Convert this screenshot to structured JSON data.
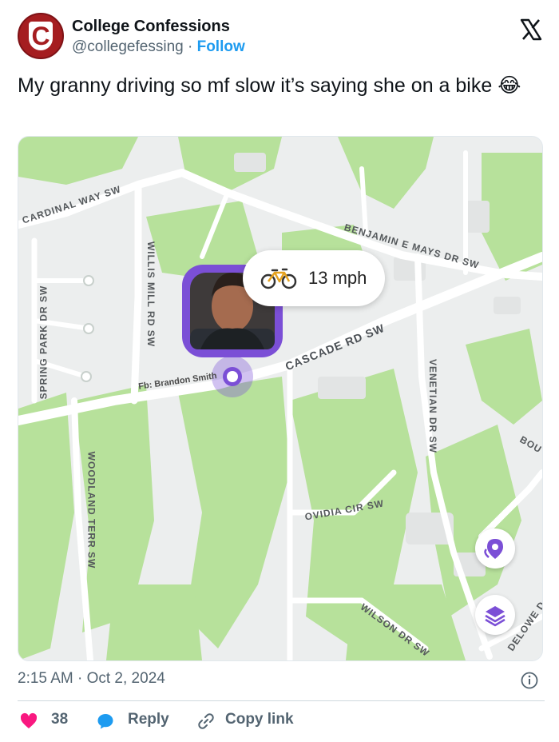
{
  "account": {
    "name": "College Confessions",
    "handle": "@collegefessing",
    "separator": "·",
    "follow_label": "Follow",
    "avatar_letter": "C"
  },
  "tweet": {
    "text": "My granny driving so mf slow it’s saying she on a bike 😂"
  },
  "map": {
    "speed_label": "13 mph",
    "fb_label": "Fb: Brandon Smith",
    "streets": {
      "cardinal": "CARDINAL WAY SW",
      "benjamin": "BENJAMIN E MAYS DR SW",
      "spring_park": "SPRING PARK DR SW",
      "willis_mill": "WILLIS MILL RD SW",
      "cascade": "CASCADE RD SW",
      "venetian": "VENETIAN DR SW",
      "woodland": "WOODLAND TERR SW",
      "ovidia": "OVIDIA CIR SW",
      "wilson": "WILSON DR SW",
      "delowe": "DELOWE D",
      "bou": "BOU"
    },
    "icons": [
      "bicycle-icon",
      "location-pin-icon",
      "layers-icon"
    ],
    "accent_color": "#7b4fd6",
    "park_color": "#b7e19b"
  },
  "footer": {
    "timestamp": "2:15 AM · Oct 2, 2024",
    "like_count": "38",
    "reply_label": "Reply",
    "copy_link_label": "Copy link"
  },
  "colors": {
    "brand": "#a51d20",
    "link": "#1d9bf0",
    "heart": "#f91880",
    "muted": "#536471"
  }
}
